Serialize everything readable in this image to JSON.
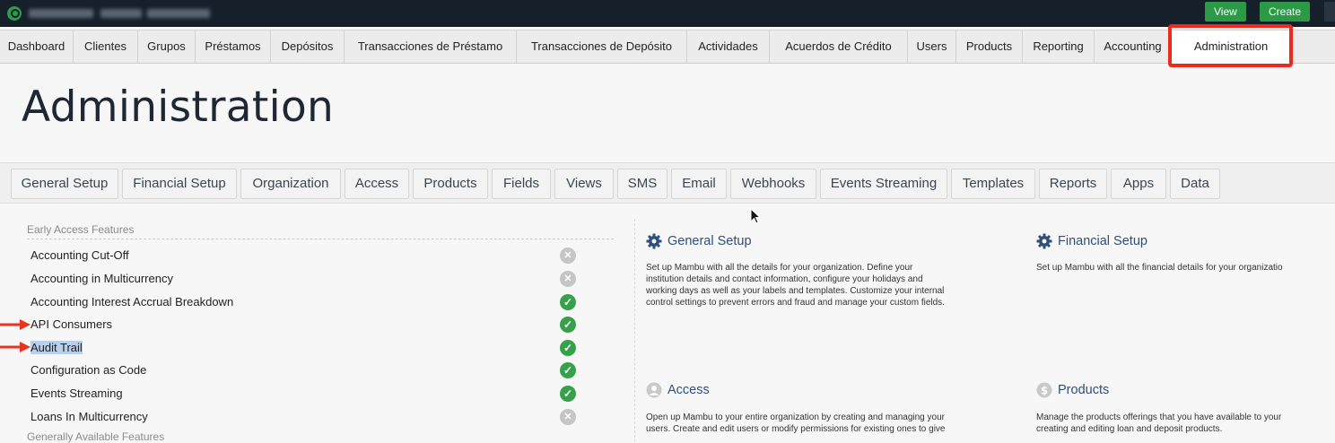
{
  "topbar": {
    "buttons": {
      "view": "View",
      "create": "Create"
    }
  },
  "nav": {
    "items": [
      "Dashboard",
      "Clientes",
      "Grupos",
      "Préstamos",
      "Depósitos",
      "Transacciones de Préstamo",
      "Transacciones de Depósito",
      "Actividades",
      "Acuerdos de Crédito",
      "Users",
      "Products",
      "Reporting",
      "Accounting",
      "Administration"
    ],
    "active": "Administration",
    "highlight_color": "#ee2a1c"
  },
  "page": {
    "title": "Administration"
  },
  "tabs": [
    "General Setup",
    "Financial Setup",
    "Organization",
    "Access",
    "Products",
    "Fields",
    "Views",
    "SMS",
    "Email",
    "Webhooks",
    "Events Streaming",
    "Templates",
    "Reports",
    "Apps",
    "Data"
  ],
  "features": {
    "early_access_heading": "Early Access Features",
    "generally_available_heading": "Generally Available Features",
    "items": [
      {
        "label": "Accounting Cut-Off",
        "enabled": false,
        "icon": "x-circle-icon"
      },
      {
        "label": "Accounting in Multicurrency",
        "enabled": false,
        "icon": "x-circle-icon"
      },
      {
        "label": "Accounting Interest Accrual Breakdown",
        "enabled": true,
        "icon": "check-circle-icon"
      },
      {
        "label": "API Consumers",
        "enabled": true,
        "icon": "check-circle-icon"
      },
      {
        "label": "Audit Trail",
        "enabled": true,
        "icon": "check-circle-icon"
      },
      {
        "label": "Configuration as Code",
        "enabled": true,
        "icon": "check-circle-icon"
      },
      {
        "label": "Events Streaming",
        "enabled": true,
        "icon": "check-circle-icon"
      },
      {
        "label": "Loans In Multicurrency",
        "enabled": false,
        "icon": "x-circle-icon"
      }
    ],
    "selected": "Audit Trail",
    "enabled_color": "#35a24a",
    "disabled_color": "#c5c5c5"
  },
  "cards": {
    "general_setup": {
      "title": "General Setup",
      "icon": "gear-icon",
      "desc": [
        "Set up Mambu with all the details for your organization. Define your",
        "institution details and contact information, configure your holidays and",
        "working days as well as your labels and templates. Customize your internal",
        "control settings to prevent errors and fraud and manage your custom fields."
      ]
    },
    "financial_setup": {
      "title": "Financial Setup",
      "icon": "gear-icon",
      "desc": [
        "Set up Mambu with all the financial details for your organizatio"
      ]
    },
    "access": {
      "title": "Access",
      "icon": "user-icon",
      "desc": [
        "Open up Mambu to your entire organization by creating and managing your",
        "users. Create and edit users or modify permissions for existing ones to give"
      ]
    },
    "products": {
      "title": "Products",
      "icon": "dollar-icon",
      "desc": [
        "Manage the products offerings that you have available to your",
        "creating and editing loan and deposit products."
      ]
    }
  }
}
